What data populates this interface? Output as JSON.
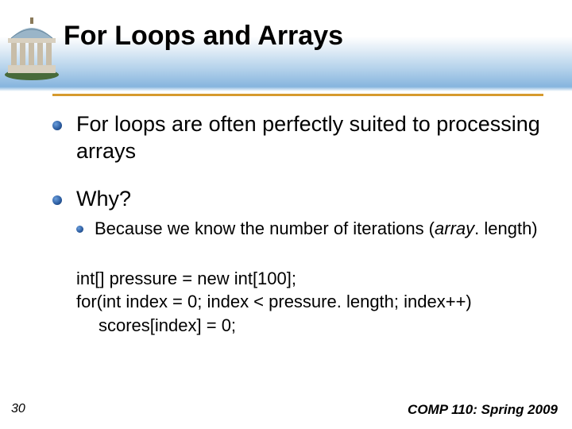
{
  "title": "For Loops and Arrays",
  "bullets": {
    "b1": "For loops are often perfectly suited to processing arrays",
    "b2": "Why?",
    "sub1_prefix": "Because we know the number of iterations (",
    "sub1_italic": "array",
    "sub1_suffix": ". length)"
  },
  "code": {
    "line1": "int[] pressure = new int[100];",
    "line2": "for(int index = 0; index < pressure. length; index++)",
    "line3": "scores[index] = 0;"
  },
  "page_number": "30",
  "footer": "COMP 110: Spring 2009"
}
